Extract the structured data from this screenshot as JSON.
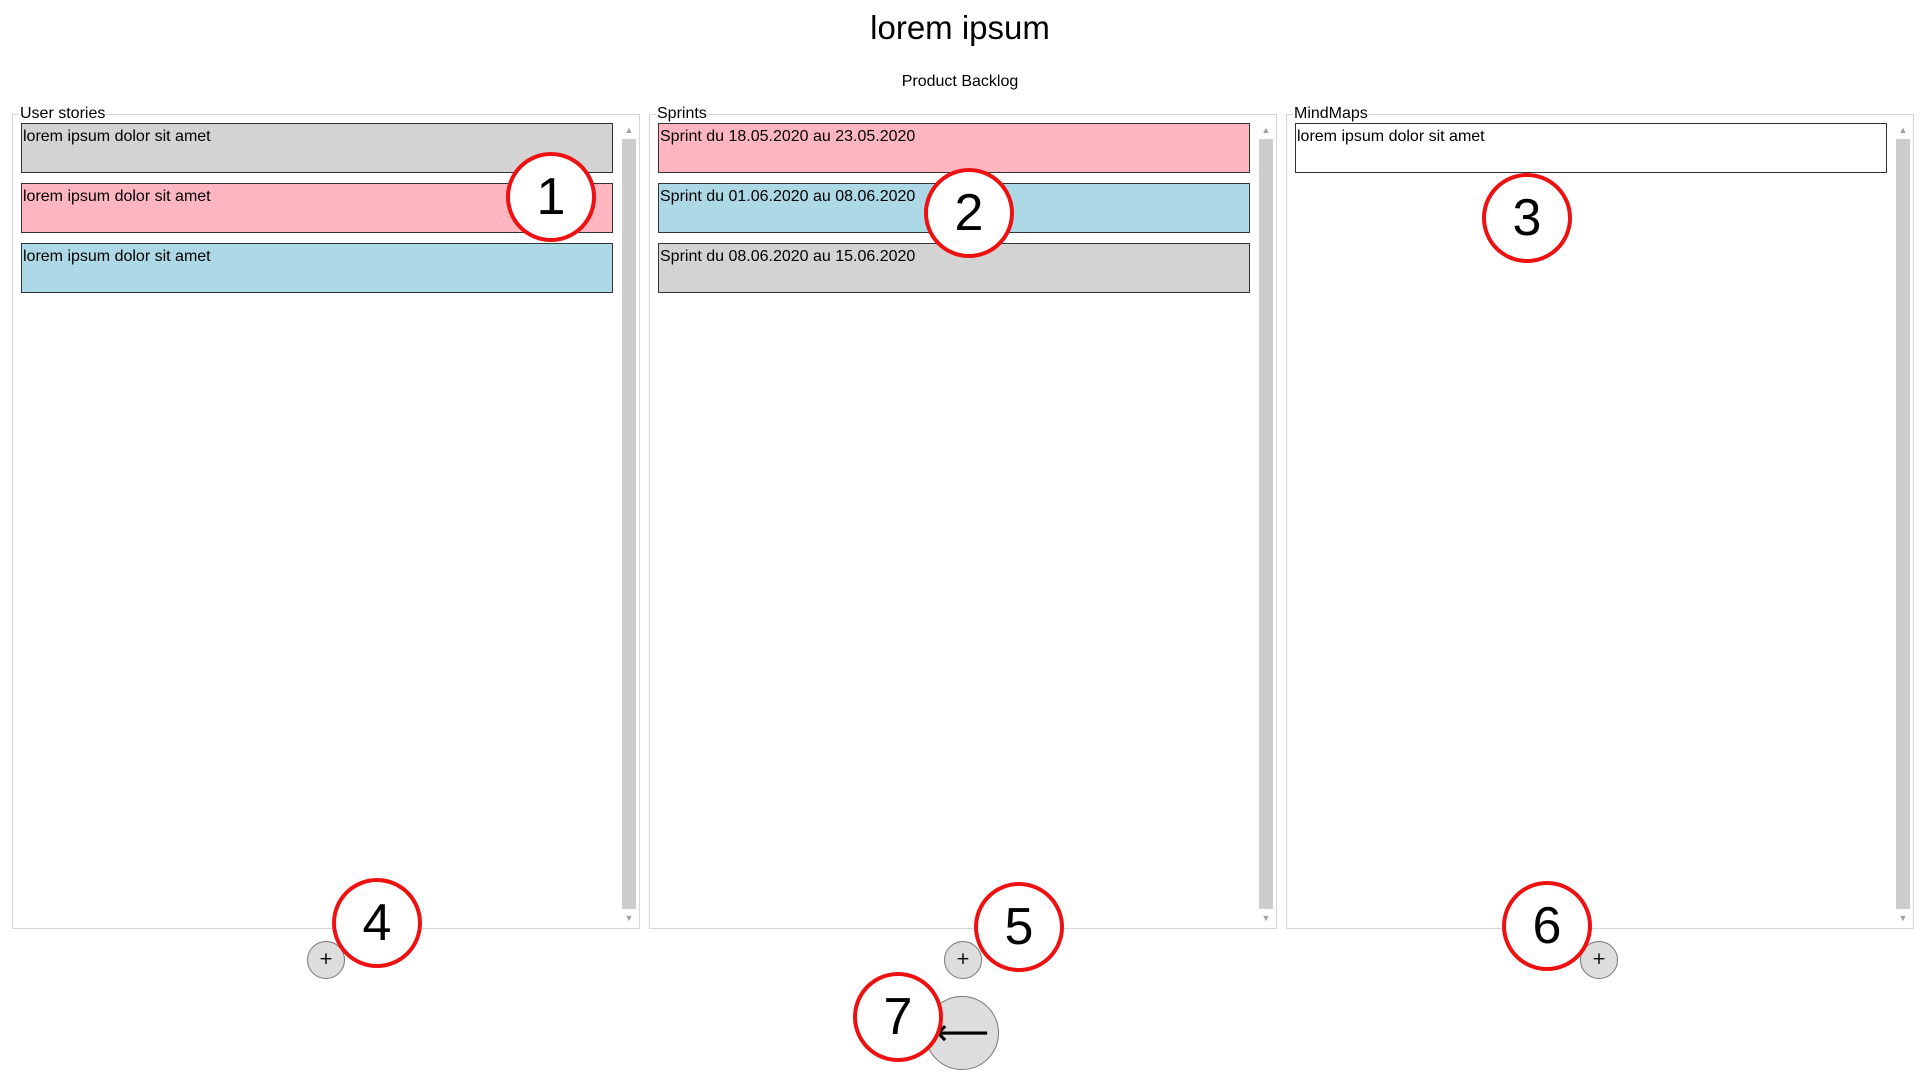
{
  "header": {
    "title": "lorem ipsum",
    "subtitle": "Product Backlog"
  },
  "colors": {
    "gray": "#d3d3d3",
    "pink": "#ffb6c1",
    "blue": "#add8e6",
    "white": "#ffffff",
    "marker_red": "#ee1111"
  },
  "panels": [
    {
      "legend": "User stories",
      "items": [
        {
          "text": "lorem ipsum dolor sit amet",
          "color": "#d3d3d3"
        },
        {
          "text": "lorem ipsum dolor sit amet",
          "color": "#ffb6c1"
        },
        {
          "text": "lorem ipsum dolor sit amet",
          "color": "#add8e6"
        }
      ],
      "add_label": "+"
    },
    {
      "legend": "Sprints",
      "items": [
        {
          "text": "Sprint du 18.05.2020 au 23.05.2020",
          "color": "#ffb6c1"
        },
        {
          "text": "Sprint du 01.06.2020 au 08.06.2020",
          "color": "#add8e6"
        },
        {
          "text": "Sprint du 08.06.2020 au 15.06.2020",
          "color": "#d3d3d3"
        }
      ],
      "add_label": "+"
    },
    {
      "legend": "MindMaps",
      "items": [
        {
          "text": "lorem ipsum dolor sit amet",
          "color": "#ffffff"
        }
      ],
      "add_label": "+"
    }
  ],
  "back_button": {
    "label": "⟵",
    "icon": "back-arrow-icon"
  },
  "scroll_icons": {
    "up": "▲",
    "down": "▼"
  },
  "markers": [
    "1",
    "2",
    "3",
    "4",
    "5",
    "6",
    "7"
  ]
}
